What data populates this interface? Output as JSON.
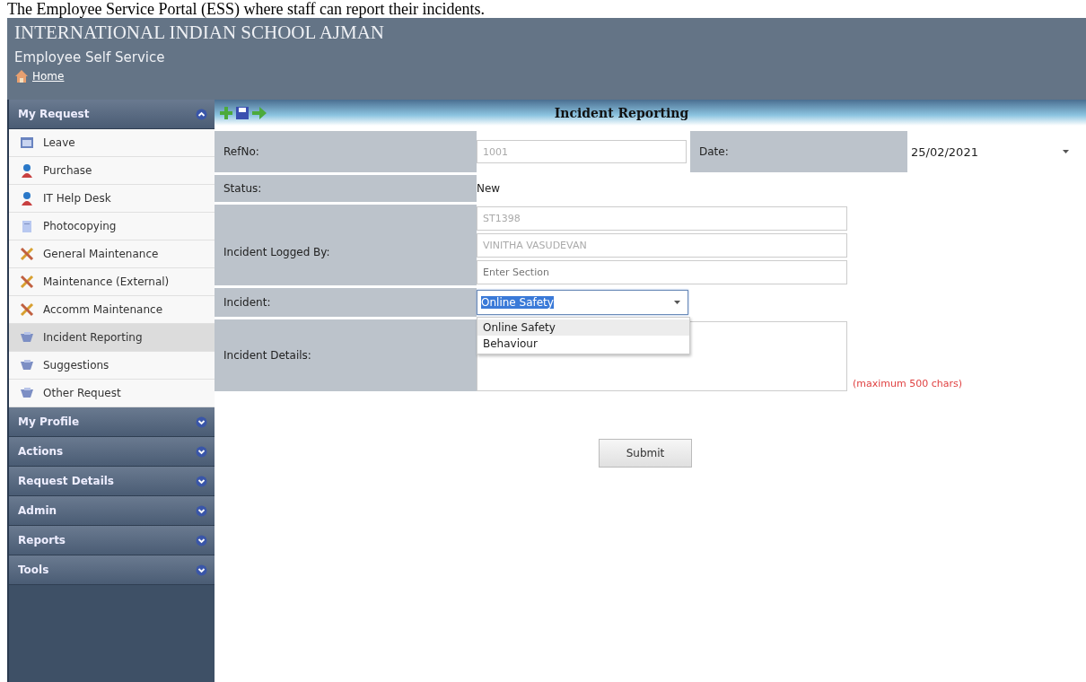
{
  "caption": "The Employee Service Portal (ESS) where staff can report their incidents.",
  "header": {
    "school": "INTERNATIONAL INDIAN SCHOOL AJMAN",
    "subtitle": "Employee Self Service",
    "home_link": "Home"
  },
  "sidebar": {
    "sections": [
      {
        "title": "My Request",
        "expanded": true,
        "items": [
          {
            "label": "Leave",
            "selected": false
          },
          {
            "label": "Purchase",
            "selected": false
          },
          {
            "label": "IT Help Desk",
            "selected": false
          },
          {
            "label": "Photocopying",
            "selected": false
          },
          {
            "label": "General Maintenance",
            "selected": false
          },
          {
            "label": "Maintenance (External)",
            "selected": false
          },
          {
            "label": "Accomm Maintenance",
            "selected": false
          },
          {
            "label": "Incident Reporting",
            "selected": true
          },
          {
            "label": "Suggestions",
            "selected": false
          },
          {
            "label": "Other Request",
            "selected": false
          }
        ]
      },
      {
        "title": "My Profile",
        "expanded": false
      },
      {
        "title": "Actions",
        "expanded": false
      },
      {
        "title": "Request Details",
        "expanded": false
      },
      {
        "title": "Admin",
        "expanded": false
      },
      {
        "title": "Reports",
        "expanded": false
      },
      {
        "title": "Tools",
        "expanded": false
      }
    ]
  },
  "page_title": "Incident Reporting",
  "form": {
    "refno": {
      "label": "RefNo:",
      "value": "1001"
    },
    "date": {
      "label": "Date:",
      "value": "25/02/2021"
    },
    "status": {
      "label": "Status:",
      "value": "New"
    },
    "logged_by": {
      "label": "Incident Logged By:",
      "fields": [
        {
          "value": "ST1398"
        },
        {
          "value": "VINITHA VASUDEVAN"
        },
        {
          "placeholder": "Enter Section"
        }
      ]
    },
    "incident": {
      "label": "Incident:",
      "value": "Online Safety",
      "expanded": true,
      "options": [
        {
          "label": "Online Safety",
          "selected": true
        },
        {
          "label": "Behaviour",
          "selected": false
        }
      ]
    },
    "details": {
      "label": "Incident Details:",
      "note": "(maximum 500 chars)"
    },
    "submit": "Submit"
  }
}
